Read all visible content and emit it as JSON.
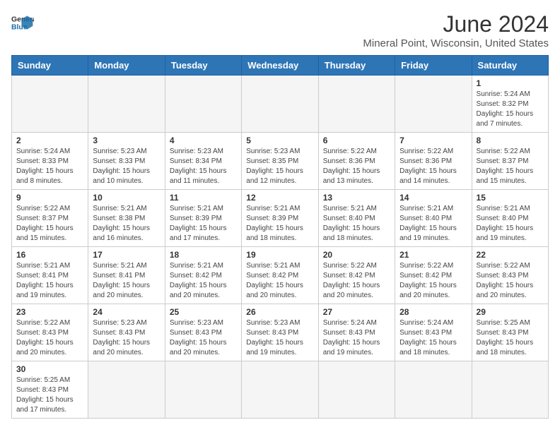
{
  "header": {
    "logo_line1": "General",
    "logo_line2": "Blue",
    "month_year": "June 2024",
    "location": "Mineral Point, Wisconsin, United States"
  },
  "days_of_week": [
    "Sunday",
    "Monday",
    "Tuesday",
    "Wednesday",
    "Thursday",
    "Friday",
    "Saturday"
  ],
  "weeks": [
    [
      {
        "day": "",
        "info": ""
      },
      {
        "day": "",
        "info": ""
      },
      {
        "day": "",
        "info": ""
      },
      {
        "day": "",
        "info": ""
      },
      {
        "day": "",
        "info": ""
      },
      {
        "day": "",
        "info": ""
      },
      {
        "day": "1",
        "info": "Sunrise: 5:24 AM\nSunset: 8:32 PM\nDaylight: 15 hours\nand 7 minutes."
      }
    ],
    [
      {
        "day": "2",
        "info": "Sunrise: 5:24 AM\nSunset: 8:33 PM\nDaylight: 15 hours\nand 8 minutes."
      },
      {
        "day": "3",
        "info": "Sunrise: 5:23 AM\nSunset: 8:33 PM\nDaylight: 15 hours\nand 10 minutes."
      },
      {
        "day": "4",
        "info": "Sunrise: 5:23 AM\nSunset: 8:34 PM\nDaylight: 15 hours\nand 11 minutes."
      },
      {
        "day": "5",
        "info": "Sunrise: 5:23 AM\nSunset: 8:35 PM\nDaylight: 15 hours\nand 12 minutes."
      },
      {
        "day": "6",
        "info": "Sunrise: 5:22 AM\nSunset: 8:36 PM\nDaylight: 15 hours\nand 13 minutes."
      },
      {
        "day": "7",
        "info": "Sunrise: 5:22 AM\nSunset: 8:36 PM\nDaylight: 15 hours\nand 14 minutes."
      },
      {
        "day": "8",
        "info": "Sunrise: 5:22 AM\nSunset: 8:37 PM\nDaylight: 15 hours\nand 15 minutes."
      }
    ],
    [
      {
        "day": "9",
        "info": "Sunrise: 5:22 AM\nSunset: 8:37 PM\nDaylight: 15 hours\nand 15 minutes."
      },
      {
        "day": "10",
        "info": "Sunrise: 5:21 AM\nSunset: 8:38 PM\nDaylight: 15 hours\nand 16 minutes."
      },
      {
        "day": "11",
        "info": "Sunrise: 5:21 AM\nSunset: 8:39 PM\nDaylight: 15 hours\nand 17 minutes."
      },
      {
        "day": "12",
        "info": "Sunrise: 5:21 AM\nSunset: 8:39 PM\nDaylight: 15 hours\nand 18 minutes."
      },
      {
        "day": "13",
        "info": "Sunrise: 5:21 AM\nSunset: 8:40 PM\nDaylight: 15 hours\nand 18 minutes."
      },
      {
        "day": "14",
        "info": "Sunrise: 5:21 AM\nSunset: 8:40 PM\nDaylight: 15 hours\nand 19 minutes."
      },
      {
        "day": "15",
        "info": "Sunrise: 5:21 AM\nSunset: 8:40 PM\nDaylight: 15 hours\nand 19 minutes."
      }
    ],
    [
      {
        "day": "16",
        "info": "Sunrise: 5:21 AM\nSunset: 8:41 PM\nDaylight: 15 hours\nand 19 minutes."
      },
      {
        "day": "17",
        "info": "Sunrise: 5:21 AM\nSunset: 8:41 PM\nDaylight: 15 hours\nand 20 minutes."
      },
      {
        "day": "18",
        "info": "Sunrise: 5:21 AM\nSunset: 8:42 PM\nDaylight: 15 hours\nand 20 minutes."
      },
      {
        "day": "19",
        "info": "Sunrise: 5:21 AM\nSunset: 8:42 PM\nDaylight: 15 hours\nand 20 minutes."
      },
      {
        "day": "20",
        "info": "Sunrise: 5:22 AM\nSunset: 8:42 PM\nDaylight: 15 hours\nand 20 minutes."
      },
      {
        "day": "21",
        "info": "Sunrise: 5:22 AM\nSunset: 8:42 PM\nDaylight: 15 hours\nand 20 minutes."
      },
      {
        "day": "22",
        "info": "Sunrise: 5:22 AM\nSunset: 8:43 PM\nDaylight: 15 hours\nand 20 minutes."
      }
    ],
    [
      {
        "day": "23",
        "info": "Sunrise: 5:22 AM\nSunset: 8:43 PM\nDaylight: 15 hours\nand 20 minutes."
      },
      {
        "day": "24",
        "info": "Sunrise: 5:23 AM\nSunset: 8:43 PM\nDaylight: 15 hours\nand 20 minutes."
      },
      {
        "day": "25",
        "info": "Sunrise: 5:23 AM\nSunset: 8:43 PM\nDaylight: 15 hours\nand 20 minutes."
      },
      {
        "day": "26",
        "info": "Sunrise: 5:23 AM\nSunset: 8:43 PM\nDaylight: 15 hours\nand 19 minutes."
      },
      {
        "day": "27",
        "info": "Sunrise: 5:24 AM\nSunset: 8:43 PM\nDaylight: 15 hours\nand 19 minutes."
      },
      {
        "day": "28",
        "info": "Sunrise: 5:24 AM\nSunset: 8:43 PM\nDaylight: 15 hours\nand 18 minutes."
      },
      {
        "day": "29",
        "info": "Sunrise: 5:25 AM\nSunset: 8:43 PM\nDaylight: 15 hours\nand 18 minutes."
      }
    ],
    [
      {
        "day": "30",
        "info": "Sunrise: 5:25 AM\nSunset: 8:43 PM\nDaylight: 15 hours\nand 17 minutes."
      },
      {
        "day": "",
        "info": ""
      },
      {
        "day": "",
        "info": ""
      },
      {
        "day": "",
        "info": ""
      },
      {
        "day": "",
        "info": ""
      },
      {
        "day": "",
        "info": ""
      },
      {
        "day": "",
        "info": ""
      }
    ]
  ]
}
